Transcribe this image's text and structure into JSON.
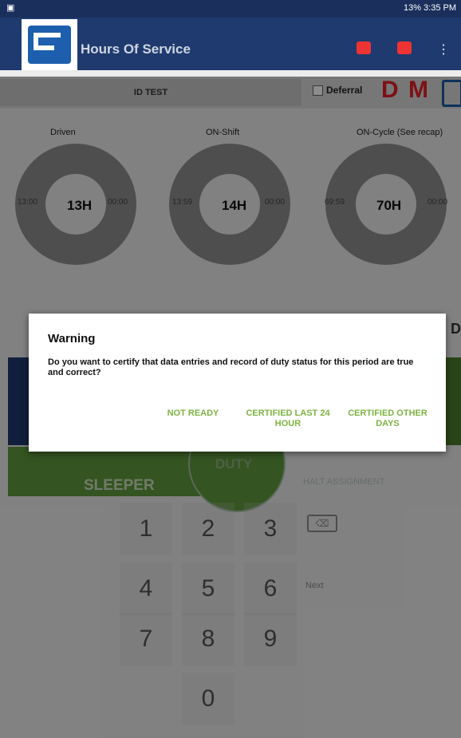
{
  "status_bar": {
    "left_icon": "image-icon",
    "right_text": "13% 3:35 PM"
  },
  "app_bar": {
    "title": "Hours Of Service",
    "menu": "⋮"
  },
  "top_strip": {
    "driver_id": "ID TEST",
    "deferral_label": "Deferral",
    "d_label": "D",
    "m_label": "M"
  },
  "gauges": [
    {
      "label": "Driven",
      "value": "13H",
      "left": "13:00",
      "right": "00:00"
    },
    {
      "label": "ON-Shift",
      "value": "14H",
      "left": "13:59",
      "right": "00:00"
    },
    {
      "label": "ON-Cycle (See recap)",
      "value": "70H",
      "left": "69:59",
      "right": "00:00"
    }
  ],
  "background": {
    "sleeper_label": "SLEEPER",
    "duty_label": "DUTY",
    "faint_right": "HALT ASSIGNMENT",
    "keypad": [
      "1",
      "2",
      "3",
      "4",
      "5",
      "6",
      "7",
      "8",
      "9",
      "0"
    ],
    "backspace": "⌫",
    "next_label": "Next",
    "edge_char": "D"
  },
  "dialog": {
    "title": "Warning",
    "message": "Do you want to certify that data entries and record of duty status for this period are true and correct?",
    "buttons": [
      "NOT READY",
      "CERTIFIED LAST 24 HOUR",
      "CERTIFIED OTHER DAYS"
    ],
    "button_color": "#7cb342"
  }
}
